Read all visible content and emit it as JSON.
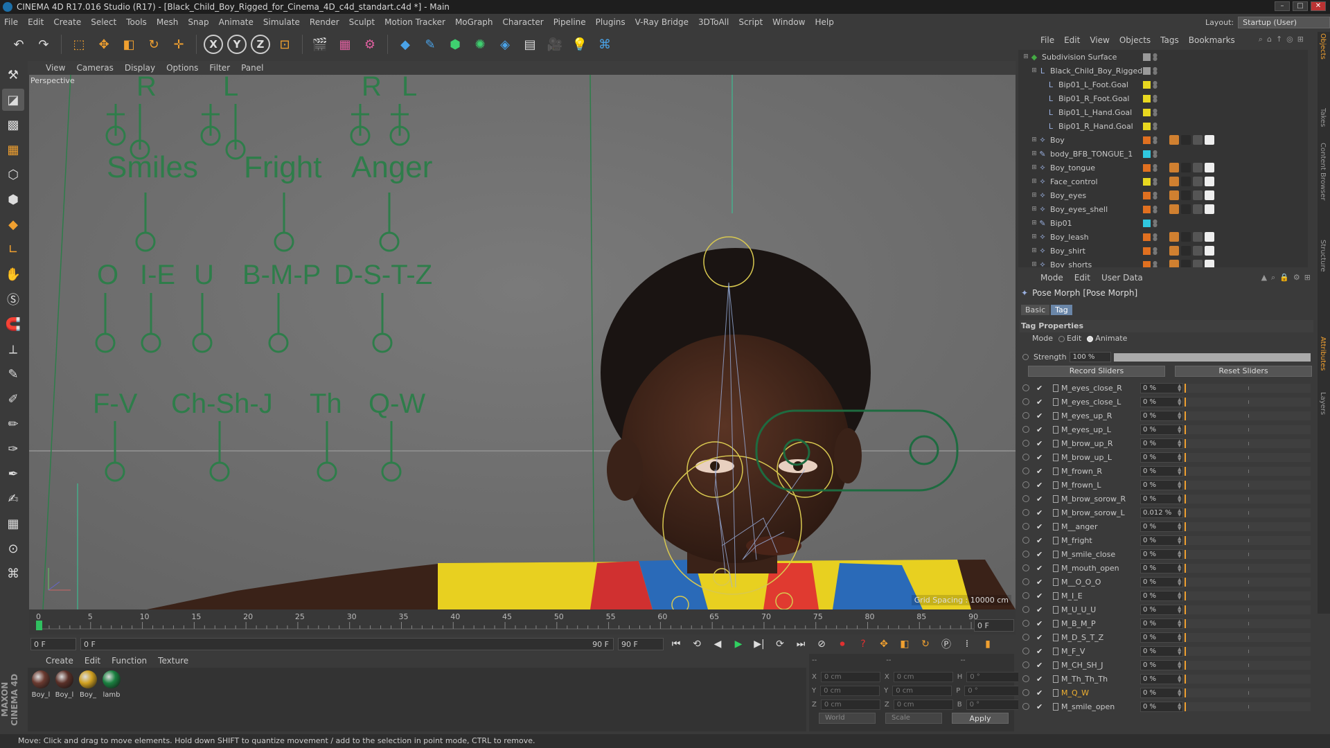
{
  "window": {
    "title": "CINEMA 4D R17.016 Studio (R17) - [Black_Child_Boy_Rigged_for_Cinema_4D_c4d_standart.c4d *] - Main"
  },
  "menubar": [
    "File",
    "Edit",
    "Create",
    "Select",
    "Tools",
    "Mesh",
    "Snap",
    "Animate",
    "Simulate",
    "Render",
    "Sculpt",
    "Motion Tracker",
    "MoGraph",
    "Character",
    "Pipeline",
    "Plugins",
    "V-Ray Bridge",
    "3DToAll",
    "Script",
    "Window",
    "Help"
  ],
  "layout": {
    "label": "Layout:",
    "value": "Startup (User)"
  },
  "viewport": {
    "menu": [
      "View",
      "Cameras",
      "Display",
      "Options",
      "Filter",
      "Panel"
    ],
    "label": "Perspective",
    "grid_spacing": "Grid Spacing : 10000 cm",
    "top_letters": [
      "R",
      "L",
      "R",
      "L"
    ],
    "row1_labels": [
      "Smiles",
      "Fright",
      "Anger"
    ],
    "row2_labels": [
      "O",
      "I-E",
      "U",
      "B-M-P",
      "D-S-T-Z"
    ],
    "row3_labels": [
      "F-V",
      "Ch-Sh-J",
      "Th",
      "Q-W"
    ]
  },
  "timeline": {
    "ticks": [
      "0",
      "5",
      "10",
      "15",
      "20",
      "25",
      "30",
      "35",
      "40",
      "45",
      "50",
      "55",
      "60",
      "65",
      "70",
      "75",
      "80",
      "85",
      "90"
    ],
    "end_frame": "0 F",
    "current": "0 F",
    "range_start": "0 F",
    "range_end": "90 F",
    "range_end2": "90 F"
  },
  "materials": {
    "menu": [
      "Create",
      "Edit",
      "Function",
      "Texture"
    ],
    "items": [
      {
        "label": "Boy_l",
        "color": "#6a3a30"
      },
      {
        "label": "Boy_l",
        "color": "#5a3028"
      },
      {
        "label": "Boy_",
        "color": "#d0a020"
      },
      {
        "label": "lamb",
        "color": "#1a8040"
      }
    ]
  },
  "coords": {
    "header": [
      "--",
      "--",
      "--"
    ],
    "rows": [
      {
        "a": "X",
        "av": "0 cm",
        "b": "X",
        "bv": "0 cm",
        "c": "H",
        "cv": "0 °"
      },
      {
        "a": "Y",
        "av": "0 cm",
        "b": "Y",
        "bv": "0 cm",
        "c": "P",
        "cv": "0 °"
      },
      {
        "a": "Z",
        "av": "0 cm",
        "b": "Z",
        "bv": "0 cm",
        "c": "B",
        "cv": "0 °"
      }
    ],
    "world": "World",
    "scale": "Scale",
    "apply": "Apply"
  },
  "status": "Move: Click and drag to move elements. Hold down SHIFT to quantize movement / add to the selection in point mode, CTRL to remove.",
  "objects": {
    "menu": [
      "File",
      "Edit",
      "View",
      "Objects",
      "Tags",
      "Bookmarks"
    ],
    "items": [
      {
        "name": "Subdivision Surface",
        "indent": 0,
        "color": "#9a9a9a",
        "icon": "◆"
      },
      {
        "name": "Black_Child_Boy_Rigged",
        "indent": 1,
        "color": "#9a9a9a",
        "icon": "L"
      },
      {
        "name": "Bip01_L_Foot.Goal",
        "indent": 2,
        "color": "#e8d820",
        "icon": "L"
      },
      {
        "name": "Bip01_R_Foot.Goal",
        "indent": 2,
        "color": "#e8d820",
        "icon": "L"
      },
      {
        "name": "Bip01_L_Hand.Goal",
        "indent": 2,
        "color": "#e8d820",
        "icon": "L"
      },
      {
        "name": "Bip01_R_Hand.Goal",
        "indent": 2,
        "color": "#e8d820",
        "icon": "L"
      },
      {
        "name": "Boy",
        "indent": 1,
        "color": "#e07020",
        "icon": "⟡"
      },
      {
        "name": "body_BFB_TONGUE_1",
        "indent": 1,
        "color": "#30c8e0",
        "icon": "✎"
      },
      {
        "name": "Boy_tongue",
        "indent": 1,
        "color": "#e07020",
        "icon": "⟡"
      },
      {
        "name": "Face_control",
        "indent": 1,
        "color": "#e8d820",
        "icon": "⟡"
      },
      {
        "name": "Boy_eyes",
        "indent": 1,
        "color": "#e07020",
        "icon": "⟡"
      },
      {
        "name": "Boy_eyes_shell",
        "indent": 1,
        "color": "#e07020",
        "icon": "⟡"
      },
      {
        "name": "Bip01",
        "indent": 1,
        "color": "#30c8e0",
        "icon": "✎"
      },
      {
        "name": "Boy_leash",
        "indent": 1,
        "color": "#e07020",
        "icon": "⟡"
      },
      {
        "name": "Boy_shirt",
        "indent": 1,
        "color": "#e07020",
        "icon": "⟡"
      },
      {
        "name": "Boy_shorts",
        "indent": 1,
        "color": "#e07020",
        "icon": "⟡"
      }
    ]
  },
  "attributes": {
    "menu": [
      "Mode",
      "Edit",
      "User Data"
    ],
    "title": "Pose Morph [Pose Morph]",
    "tabs": [
      "Basic",
      "Tag"
    ],
    "section": "Tag Properties",
    "mode_label": "Mode",
    "mode_options": [
      "Edit",
      "Animate"
    ],
    "strength_label": "Strength",
    "strength_value": "100 %",
    "strength_fraction": 1.0,
    "record": "Record Sliders",
    "reset": "Reset Sliders",
    "morphs": [
      {
        "name": "M_eyes_close_R",
        "value": "0 %"
      },
      {
        "name": "M_eyes_close_L",
        "value": "0 %"
      },
      {
        "name": "M_eyes_up_R",
        "value": "0 %"
      },
      {
        "name": "M_eyes_up_L",
        "value": "0 %"
      },
      {
        "name": "M_brow_up_R",
        "value": "0 %"
      },
      {
        "name": "M_brow_up_L",
        "value": "0 %"
      },
      {
        "name": "M_frown_R",
        "value": "0 %"
      },
      {
        "name": "M_frown_L",
        "value": "0 %"
      },
      {
        "name": "M_brow_sorow_R",
        "value": "0 %"
      },
      {
        "name": "M_brow_sorow_L",
        "value": "0.012 %"
      },
      {
        "name": "M__anger",
        "value": "0 %"
      },
      {
        "name": "M_fright",
        "value": "0 %"
      },
      {
        "name": "M_smile_close",
        "value": "0 %"
      },
      {
        "name": "M_mouth_open",
        "value": "0 %"
      },
      {
        "name": "M__O_O_O",
        "value": "0 %"
      },
      {
        "name": "M_I_E",
        "value": "0 %"
      },
      {
        "name": "M_U_U_U",
        "value": "0 %"
      },
      {
        "name": "M_B_M_P",
        "value": "0 %"
      },
      {
        "name": "M_D_S_T_Z",
        "value": "0 %"
      },
      {
        "name": "M_F_V",
        "value": "0 %"
      },
      {
        "name": "M_CH_SH_J",
        "value": "0 %"
      },
      {
        "name": "M_Th_Th_Th",
        "value": "0 %"
      },
      {
        "name": "M_Q_W",
        "value": "0 %"
      },
      {
        "name": "M_smile_open",
        "value": "0 %"
      }
    ]
  },
  "side_tabs": [
    "Objects",
    "Takes",
    "Content Browser",
    "Structure",
    "Attributes",
    "Layers"
  ],
  "maxon": "MAXON CINEMA 4D"
}
